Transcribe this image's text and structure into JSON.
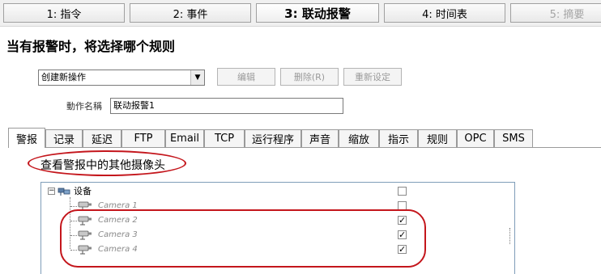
{
  "wizard": {
    "steps": [
      {
        "label": "1: 指令"
      },
      {
        "label": "2: 事件"
      },
      {
        "label": "3: 联动报警"
      },
      {
        "label": "4: 时间表"
      },
      {
        "label": "5: 摘要"
      }
    ],
    "active_step": 3
  },
  "heading": "当有报警时，将选择哪个规则",
  "action_select": {
    "value": "创建新操作"
  },
  "buttons": {
    "edit": "编辑",
    "delete": "删除(R)",
    "reset": "重新设定"
  },
  "action_name": {
    "label": "動作名稱",
    "value": "联动报警1"
  },
  "tabs": [
    "警报",
    "记录",
    "延迟",
    "FTP",
    "Email",
    "TCP",
    "运行程序",
    "声音",
    "缩放",
    "指示",
    "规则",
    "OPC",
    "SMS"
  ],
  "active_tab": "警报",
  "alarm_option": "查看警报中的其他摄像头",
  "tree": {
    "root": {
      "label": "设备",
      "expander": "−",
      "checked": false
    },
    "cameras": [
      {
        "label": "Camera 1",
        "checked": false
      },
      {
        "label": "Camera 2",
        "checked": true
      },
      {
        "label": "Camera 3",
        "checked": true
      },
      {
        "label": "Camera 4",
        "checked": true
      }
    ]
  },
  "colors": {
    "highlight": "#c4161c"
  }
}
